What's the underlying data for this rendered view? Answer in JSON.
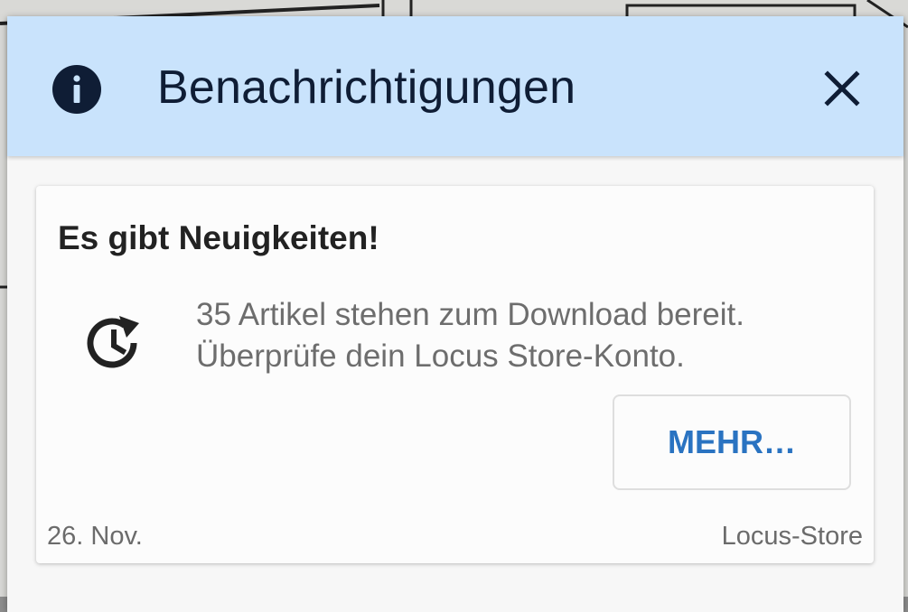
{
  "dialog": {
    "title": "Benachrichtigungen",
    "info_icon": "info-icon",
    "close_icon": "close-icon"
  },
  "notification": {
    "title": "Es gibt Neuigkeiten!",
    "icon": "history-update-icon",
    "message_line1": "35 Artikel stehen zum Download bereit.",
    "message_line2": "Überprüfe dein Locus Store-Konto.",
    "button_label": "MEHR…",
    "date": "26. Nov.",
    "source": "Locus-Store"
  },
  "colors": {
    "header_bg": "#c9e3fc",
    "title_text": "#0f1d35",
    "button_text": "#2a73c1",
    "message_text": "#6d6d6d"
  }
}
